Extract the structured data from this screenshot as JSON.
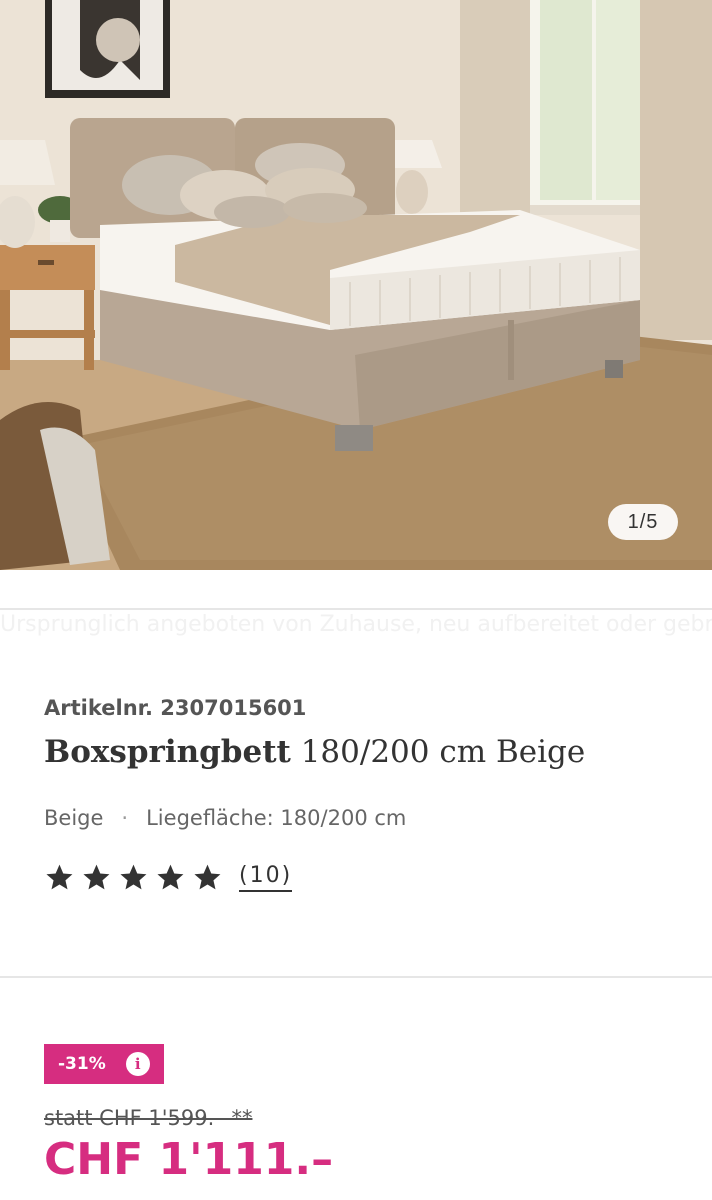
{
  "gallery": {
    "image_alt": "Boxspringbett 180/200 cm Beige in a bright bedroom",
    "counter": "1/5"
  },
  "ghost_text": "Ursprunglich angeboten von Zuhause, neu aufbereitet oder gebraucht",
  "product": {
    "article_number": "Artikelnr. 2307015601",
    "title_bold": "Boxspringbett",
    "title_rest": " 180/200 cm Beige",
    "color": "Beige",
    "separator": "·",
    "surface": "Liegefläche: 180/200 cm",
    "rating_value": 5,
    "rating_count": "(10)"
  },
  "pricing": {
    "discount": "-31%",
    "info_icon": "i",
    "old_price": "statt CHF 1'599.– **",
    "new_price": "CHF 1'111.–"
  },
  "colors": {
    "accent": "#d62d80",
    "text": "#333333"
  }
}
